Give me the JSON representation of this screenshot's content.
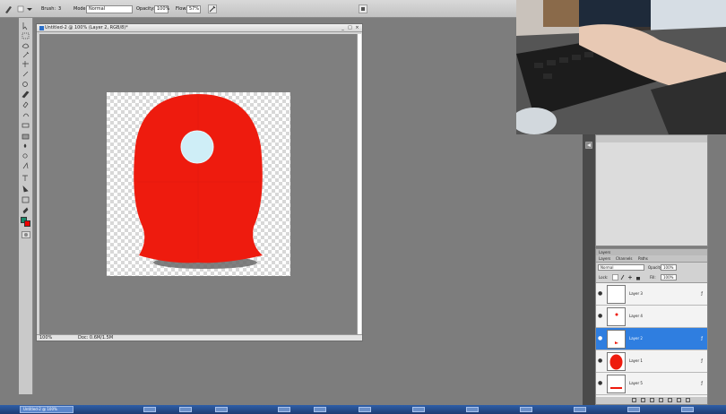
{
  "options_bar": {
    "brush_label": "Brush:",
    "brush_size": "3",
    "mode_label": "Mode:",
    "mode_value": "Normal",
    "opacity_label": "Opacity:",
    "opacity_value": "100%",
    "flow_label": "Flow:",
    "flow_value": "57%"
  },
  "document": {
    "title": "Untitled-2 @ 100% (Layer 2, RGB/8)*",
    "zoom": "100%",
    "doc_info": "Doc: 0.6M/1.5M",
    "minimize": "_",
    "maximize": "□",
    "close": "×"
  },
  "artwork": {
    "body_color": "#ee1b0e",
    "window_color": "#cfeef7",
    "shadow_color": "#6a6a6a"
  },
  "layers_panel": {
    "top_label": "Layers",
    "tabs": [
      "Layers",
      "Channels",
      "Paths"
    ],
    "blend_mode": "Normal",
    "opacity_label": "Opacity:",
    "opacity_value": "100%",
    "lock_label": "Lock:",
    "fill_label": "Fill:",
    "fill_value": "100%",
    "layers": [
      {
        "name": "Layer 3",
        "active": false,
        "fx": true
      },
      {
        "name": "Layer 4",
        "active": false,
        "fx": false
      },
      {
        "name": "Layer 2",
        "active": true,
        "fx": true
      },
      {
        "name": "Layer 1",
        "active": false,
        "fx": true
      },
      {
        "name": "Layer 5",
        "active": false,
        "fx": true
      }
    ],
    "eye_glyph": "●",
    "fx_glyph": "ƒ"
  },
  "taskbar": {
    "active_window": "Untitled-2 @ 100%"
  },
  "colors": {
    "foreground": "#1a8a6a",
    "background": "#ee0000",
    "selection_blue": "#2f7ee0"
  }
}
